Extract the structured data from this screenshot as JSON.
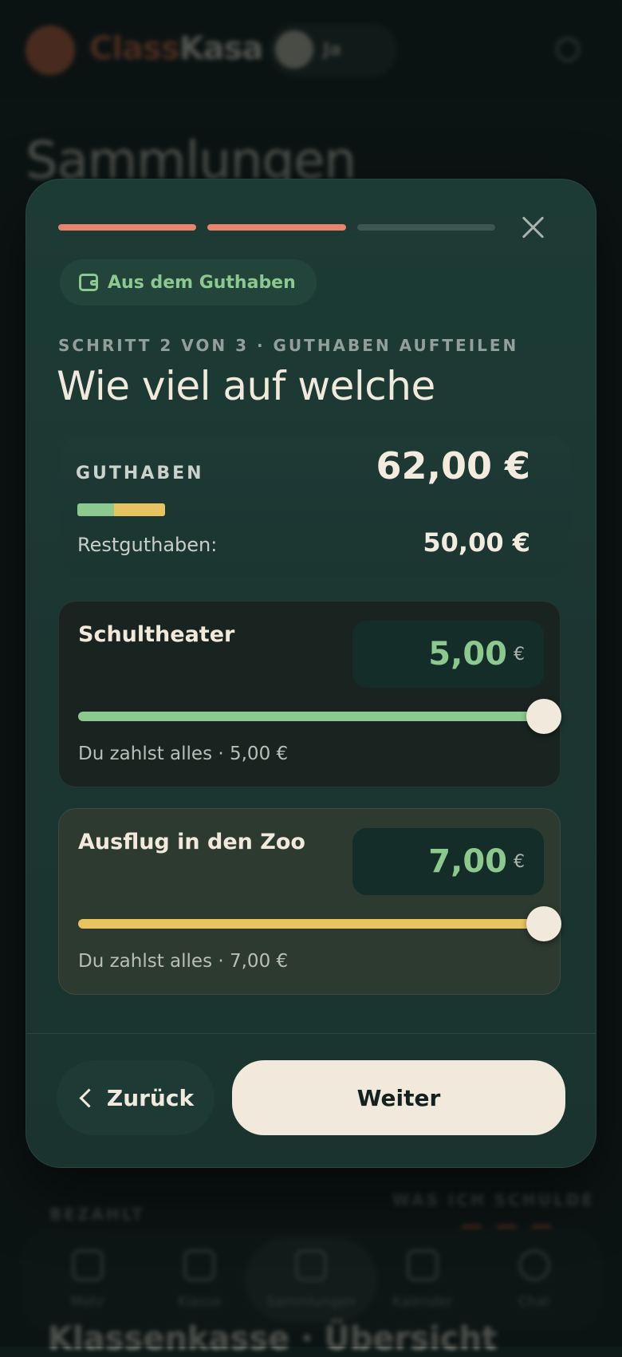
{
  "background": {
    "brand": {
      "part1": "Class",
      "part2": "Kasa"
    },
    "user_short": "Ja",
    "page_heading": "Sammlungen",
    "paid_label": "BEZAHLT",
    "owe_label": "WAS ICH SCHULDE",
    "nav": [
      {
        "label": "Mehr"
      },
      {
        "label": "Klasse"
      },
      {
        "label": "Sammlungen"
      },
      {
        "label": "Kalender"
      },
      {
        "label": "Chat"
      }
    ],
    "bottom_title": "Klassenkasse · Übersicht"
  },
  "modal": {
    "progress_steps": 3,
    "progress_completed": 2,
    "source_pill_label": "Aus dem Guthaben",
    "step_label": "SCHRITT 2 VON 3 · GUTHABEN AUFTEILEN",
    "title": "Wie viel auf welche",
    "balance": {
      "label": "GUTHABEN",
      "amount": "62,00 €",
      "rest_label": "Restguthaben:",
      "rest_amount": "50,00 €"
    },
    "items": [
      {
        "name": "Schultheater",
        "amount": "5,00",
        "currency": "€",
        "slider_fraction": 1.0,
        "note": "Du zahlst alles · 5,00 €"
      },
      {
        "name": "Ausflug in den Zoo",
        "amount": "7,00",
        "currency": "€",
        "slider_fraction": 1.0,
        "note": "Du zahlst alles · 7,00 €"
      }
    ],
    "back_label": "Zurück",
    "next_label": "Weiter"
  },
  "colors": {
    "accent_coral": "#e9836b",
    "accent_green": "#8cc98e",
    "accent_yellow": "#e7c460",
    "progress_inactive": "#3e5550",
    "cream": "#f1eadc"
  }
}
